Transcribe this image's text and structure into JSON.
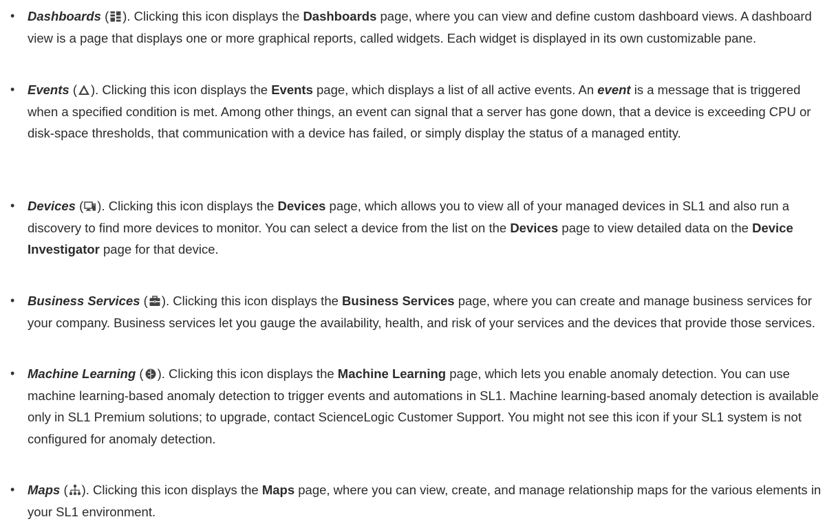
{
  "items": [
    {
      "term": "Dashboards",
      "icon": "dashboards-icon",
      "p1": ". Clicking this icon displays the ",
      "b1": "Dashboards",
      "p2": " page, where you can view and define custom dashboard views. A dashboard view is a page that displays one or more graphical reports, called widgets. Each widget is displayed in its own customizable pane."
    },
    {
      "term": "Events",
      "icon": "events-icon",
      "p1": ". Clicking this icon displays the ",
      "b1": "Events",
      "p2": " page, which displays a list of all active events. An ",
      "em": "event",
      "p3": " is a message that is triggered when a specified condition is met. Among other things, an event can signal that a server has gone down, that a device is exceeding CPU or disk-space thresholds, that communication with a device has failed, or simply display the status of a managed entity."
    },
    {
      "term": "Devices",
      "icon": "devices-icon",
      "p1": ". Clicking this icon displays the ",
      "b1": "Devices",
      "p2": " page, which allows you to view all of your managed devices in SL1 and also run a discovery to find more devices to monitor. You can select a device from the list on the ",
      "b2": "Devices",
      "p3": " page to view detailed data on the ",
      "b3": "Device Investigator",
      "p4": " page for that device."
    },
    {
      "term": "Business Services",
      "icon": "business-services-icon",
      "p1": ". Clicking this icon displays the ",
      "b1": "Business Services",
      "p2": " page, where you can create and manage business services for your company. Business services let you gauge the availability, health, and risk of your services and the devices that provide those services."
    },
    {
      "term": "Machine Learning",
      "icon": "machine-learning-icon",
      "p1": ". Clicking this icon displays the ",
      "b1": "Machine Learning",
      "p2": " page, which lets you enable anomaly detection. You can use machine learning-based anomaly detection to trigger events and automations in SL1. Machine learning-based anomaly detection is available only in SL1 Premium solutions; to upgrade, contact ScienceLogic Customer Support. You might not see this icon if your SL1 system is not configured for anomaly detection."
    },
    {
      "term": "Maps",
      "icon": "maps-icon",
      "p1": ". Clicking this icon displays the ",
      "b1": "Maps",
      "p2": " page, where you can view, create, and manage relationship maps for the various elements in your SL1 environment."
    }
  ]
}
